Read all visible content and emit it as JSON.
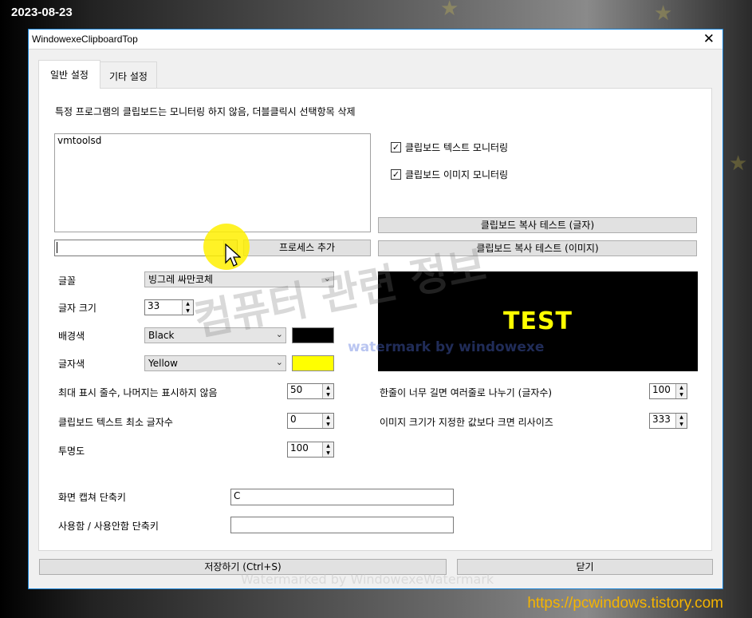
{
  "overlay": {
    "date": "2023-08-23",
    "url": "https://pcwindows.tistory.com",
    "watermark_main": "컴퓨터 관련 정보",
    "watermark_blue": "watermark by windowexe",
    "watermark_bottom": "Watermarked by WindowexeWatermark"
  },
  "window": {
    "title": "WindowexeClipboardTop",
    "close_glyph": "✕"
  },
  "tabs": [
    {
      "label": "일반 설정",
      "active": true
    },
    {
      "label": "기타 설정",
      "active": false
    }
  ],
  "general": {
    "description": "특정 프로그램의 클립보드는 모니터링 하지 않음, 더블클릭시 선택항목 삭제",
    "excluded_processes": [
      "vmtoolsd"
    ],
    "process_input_value": "",
    "add_process_button": "프로세스 추가",
    "monitor_text": {
      "label": "클립보드 텍스트 모니터링",
      "checked": true
    },
    "monitor_image": {
      "label": "클립보드 이미지 모니터링",
      "checked": true
    },
    "copy_test_text_button": "클립보드 복사 테스트 (글자)",
    "copy_test_image_button": "클립보드 복사 테스트 (이미지)",
    "font_label": "글꼴",
    "font_value": "빙그레 싸만코체",
    "font_size_label": "글자 크기",
    "font_size_value": "33",
    "bg_color_label": "배경색",
    "bg_color_value": "Black",
    "bg_color_hex": "#000000",
    "text_color_label": "글자색",
    "text_color_value": "Yellow",
    "text_color_hex": "#ffff00",
    "preview_text": "TEST",
    "max_lines_label": "최대 표시 줄수, 나머지는 표시하지 않음",
    "max_lines_value": "50",
    "wrap_label": "한줄이 너무 길면 여러줄로 나누기 (글자수)",
    "wrap_value": "100",
    "min_chars_label": "클립보드 텍스트 최소 글자수",
    "min_chars_value": "0",
    "resize_label": "이미지 크기가 지정한 값보다 크면 리사이즈",
    "resize_value": "333",
    "opacity_label": "투명도",
    "opacity_value": "100",
    "capture_hotkey_label": "화면 캡쳐 단축키",
    "capture_hotkey_value": "C",
    "toggle_hotkey_label": "사용함 / 사용안함 단축키",
    "toggle_hotkey_value": ""
  },
  "footer": {
    "save_button": "저장하기 (Ctrl+S)",
    "close_button": "닫기"
  }
}
